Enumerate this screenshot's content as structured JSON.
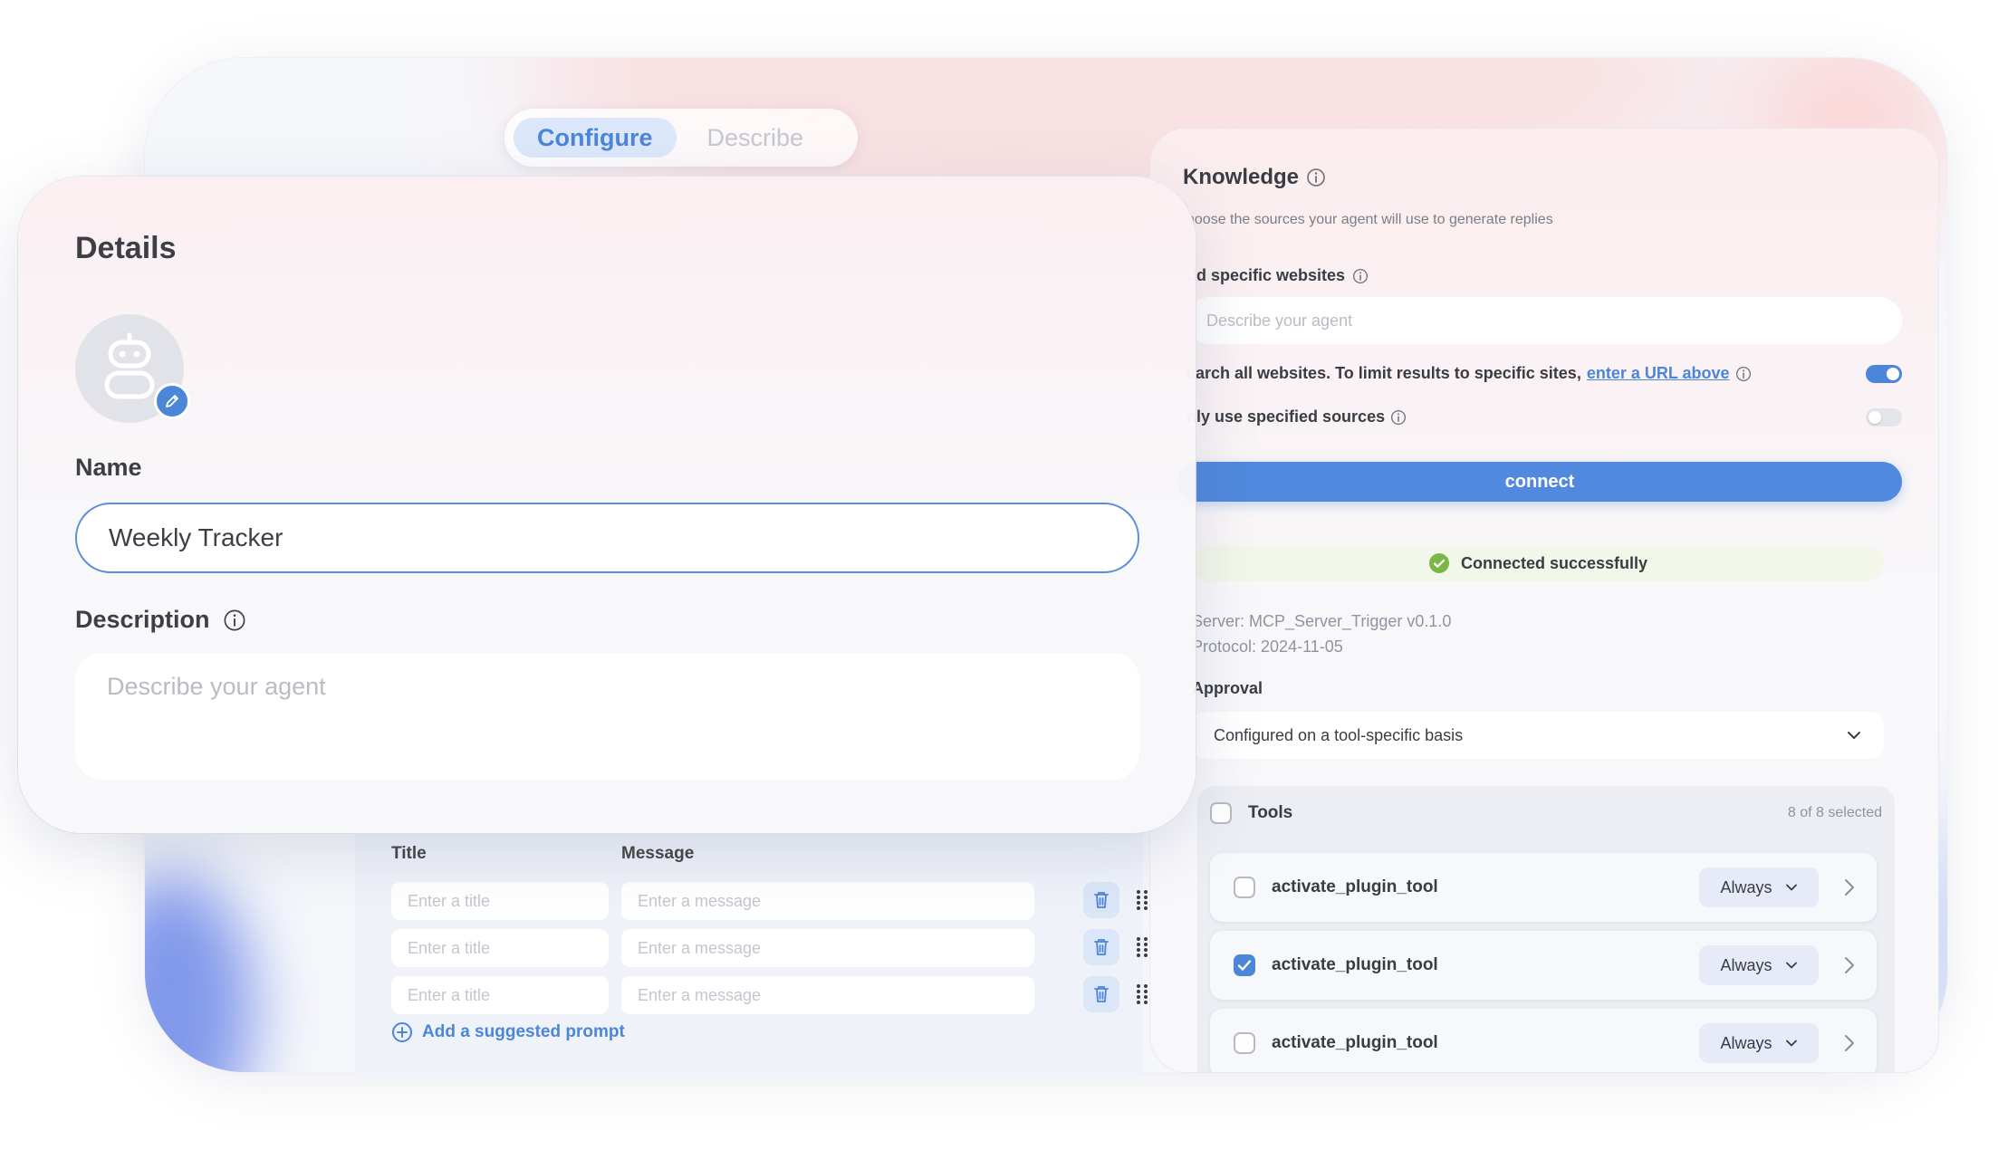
{
  "tabs": {
    "configure": "Configure",
    "describe": "Describe"
  },
  "details": {
    "title": "Details",
    "name_label": "Name",
    "name_value": "Weekly Tracker",
    "description_label": "Description",
    "description_placeholder": "Describe your agent"
  },
  "prompts": {
    "title_header": "Title",
    "message_header": "Message",
    "rows": [
      {
        "title_placeholder": "Enter a title",
        "message_placeholder": "Enter a message"
      },
      {
        "title_placeholder": "Enter a title",
        "message_placeholder": "Enter a message"
      },
      {
        "title_placeholder": "Enter a title",
        "message_placeholder": "Enter a message"
      }
    ],
    "add_label": "Add a suggested prompt"
  },
  "knowledge": {
    "title": "Knowledge",
    "subtitle": "hoose the sources your agent will use to generate replies",
    "websites_label": "dd specific websites",
    "websites_placeholder": "Describe your agent",
    "search_all_text": "earch all websites. To limit results to specific sites,",
    "search_all_link": "enter a URL above",
    "search_all_enabled": true,
    "only_sources_text": "nly use specified sources",
    "only_sources_enabled": false,
    "connect_label": "connect",
    "status_text": "Connected successfully",
    "server_line": "Server: MCP_Server_Trigger v0.1.0",
    "protocol_line": "Protocol: 2024-11-05",
    "approval_label": "Approval",
    "approval_value": "Configured on a tool-specific basis"
  },
  "tools": {
    "header": "Tools",
    "count_text": "8 of 8 selected",
    "items": [
      {
        "name": "activate_plugin_tool",
        "mode": "Always",
        "checked": false
      },
      {
        "name": "activate_plugin_tool",
        "mode": "Always",
        "checked": true
      },
      {
        "name": "activate_plugin_tool",
        "mode": "Always",
        "checked": false
      }
    ]
  },
  "colors": {
    "accent": "#4b86d9",
    "success": "#7ab648",
    "connect_button": "#5089dd"
  }
}
